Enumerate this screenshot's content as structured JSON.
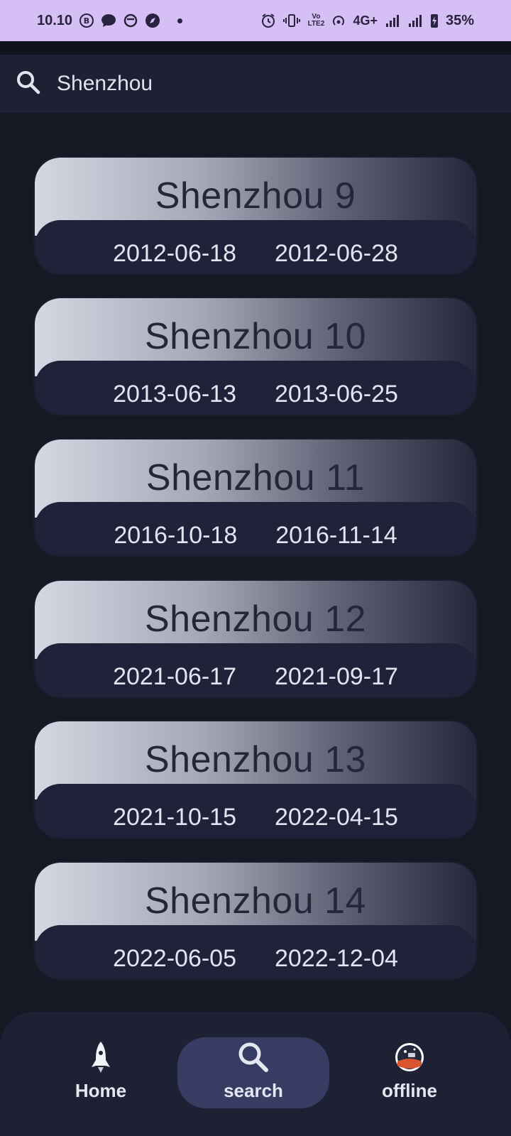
{
  "status_bar": {
    "time": "10.10",
    "network": "4G+",
    "volte": "Vo LTE2",
    "battery": "35%"
  },
  "search": {
    "query": "Shenzhou"
  },
  "missions": [
    {
      "name": "Shenzhou 9",
      "launch": "2012-06-18",
      "landing": "2012-06-28"
    },
    {
      "name": "Shenzhou 10",
      "launch": "2013-06-13",
      "landing": "2013-06-25"
    },
    {
      "name": "Shenzhou 11",
      "launch": "2016-10-18",
      "landing": "2016-11-14"
    },
    {
      "name": "Shenzhou 12",
      "launch": "2021-06-17",
      "landing": "2021-09-17"
    },
    {
      "name": "Shenzhou 13",
      "launch": "2021-10-15",
      "landing": "2022-04-15"
    },
    {
      "name": "Shenzhou 14",
      "launch": "2022-06-05",
      "landing": "2022-12-04"
    }
  ],
  "nav": {
    "items": [
      {
        "label": "Home",
        "icon": "rocket-icon"
      },
      {
        "label": "search",
        "icon": "search-icon"
      },
      {
        "label": "offline",
        "icon": "planet-badge-icon"
      }
    ],
    "active": "search"
  }
}
